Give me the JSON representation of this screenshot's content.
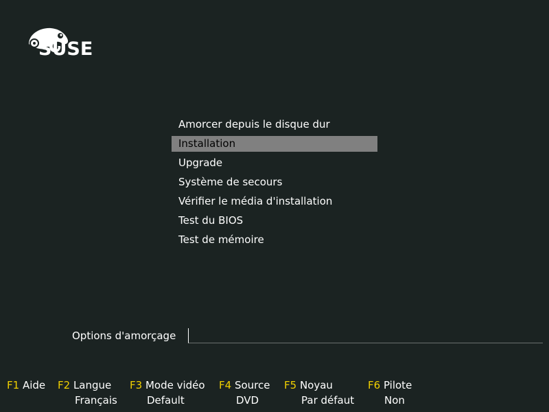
{
  "branding": {
    "logo_text": "SUSE"
  },
  "menu": {
    "items": [
      {
        "label": "Amorcer depuis le disque dur",
        "selected": false
      },
      {
        "label": "Installation",
        "selected": true
      },
      {
        "label": "Upgrade",
        "selected": false
      },
      {
        "label": "Système de secours",
        "selected": false
      },
      {
        "label": "Vérifier le média d'installation",
        "selected": false
      },
      {
        "label": "Test du BIOS",
        "selected": false
      },
      {
        "label": "Test de mémoire",
        "selected": false
      }
    ]
  },
  "boot_options": {
    "label": "Options d'amorçage",
    "value": ""
  },
  "function_keys": [
    {
      "key": "F1",
      "label": "Aide",
      "value": ""
    },
    {
      "key": "F2",
      "label": "Langue",
      "value": "Français"
    },
    {
      "key": "F3",
      "label": "Mode vidéo",
      "value": "Default"
    },
    {
      "key": "F4",
      "label": "Source",
      "value": "DVD"
    },
    {
      "key": "F5",
      "label": "Noyau",
      "value": "Par défaut"
    },
    {
      "key": "F6",
      "label": "Pilote",
      "value": "Non"
    }
  ],
  "colors": {
    "background": "#1b2322",
    "selection": "#808080",
    "fkey_accent": "#f0d000",
    "text": "#ffffff"
  }
}
